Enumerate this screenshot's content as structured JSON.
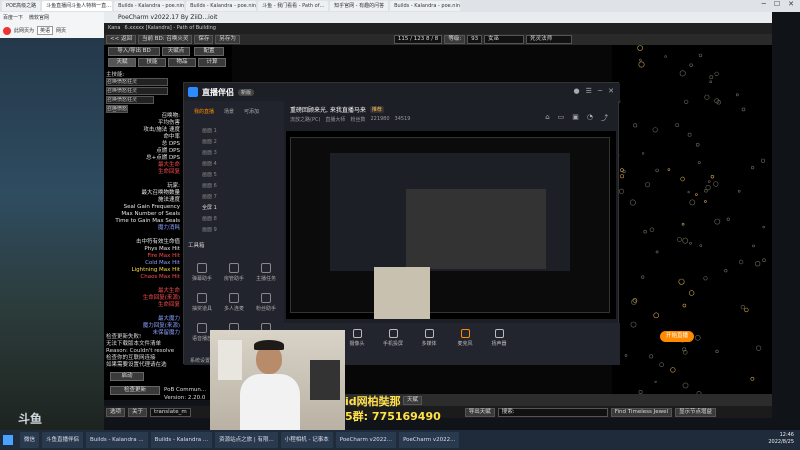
{
  "browser": {
    "tabs": [
      "POE高级之路",
      "斗鱼直播间斗鱼人特档一直…",
      "Builds - Kalandra - poe.ninja",
      "Builds - Kalandra - poe.ninj…",
      "斗鱼 - 我门看看 - Path of…",
      "知乎官网 - 有趣的问答",
      "Builds - Kalandra - poe.ninja"
    ],
    "bookmarks": [
      "百度一下",
      "微软官网"
    ],
    "nav": [
      "此网页为",
      "英语",
      "网页"
    ]
  },
  "poe": {
    "window_title": "PoeCharm v2022.17 By ZiiD...ioit",
    "doc_tabs": [
      "Kana",
      "6.xxxxx [Kalandra] - Path of Building"
    ],
    "toolbar": {
      "back": "<< 返回",
      "build_label": "当前 BD: 召唤火灵",
      "save": "保存",
      "save_as": "另存为",
      "points": "115 / 123   8 / 8",
      "level_label": "等级:",
      "level_value": "93",
      "class_value": "女巫",
      "ascend_value": "死灵法师"
    },
    "left_buttons": {
      "import_export": "导入/导出 BD",
      "notes": "天赋点",
      "config": "配置",
      "tree": "天赋",
      "skills": "技能",
      "items": "物品",
      "calcs": "计算"
    },
    "main_skill_label": "主技能:",
    "main_skill_inputs": [
      "召唤愤怒狂灵",
      "召唤愤怒狂灵",
      "召唤愤怒狂灵",
      "召唤愤怒狂灵"
    ],
    "stats": [
      {
        "t": "召唤物:",
        "c": "w"
      },
      {
        "t": "平均伤害",
        "c": "w"
      },
      {
        "t": "攻击/施法 速度",
        "c": "w"
      },
      {
        "t": "命中率",
        "c": "w"
      },
      {
        "t": "总 DPS",
        "c": "w"
      },
      {
        "t": "点燃 DPS",
        "c": "w"
      },
      {
        "t": "总+点燃 DPS",
        "c": "w"
      },
      {
        "t": "最大生命",
        "c": "r"
      },
      {
        "t": "生命回复",
        "c": "r"
      },
      {
        "t": "",
        "c": "w"
      },
      {
        "t": "玩家:",
        "c": "w"
      },
      {
        "t": "最大召唤物数量",
        "c": "w"
      },
      {
        "t": "施法速度",
        "c": "w"
      },
      {
        "t": "Seal Gain Frequency",
        "c": "w"
      },
      {
        "t": "Max Number of Seals",
        "c": "w"
      },
      {
        "t": "Time to Gain Max Seals",
        "c": "w"
      },
      {
        "t": "魔力消耗",
        "c": "b"
      },
      {
        "t": "",
        "c": "w"
      },
      {
        "t": "击中符有效生命值",
        "c": "w"
      },
      {
        "t": "Phys Max Hit",
        "c": "w"
      },
      {
        "t": "Fire Max Hit",
        "c": "r"
      },
      {
        "t": "Cold Max Hit",
        "c": "b"
      },
      {
        "t": "Lightning Max Hit",
        "c": "y"
      },
      {
        "t": "Chaos Max Hit",
        "c": "r"
      },
      {
        "t": "",
        "c": "w"
      },
      {
        "t": "最大生命",
        "c": "r"
      },
      {
        "t": "生命回复(来源)",
        "c": "r"
      },
      {
        "t": "生命回复",
        "c": "r"
      },
      {
        "t": "",
        "c": "w"
      },
      {
        "t": "最大魔力",
        "c": "b"
      },
      {
        "t": "魔力回复(来源)",
        "c": "b"
      },
      {
        "t": "未保留魔力",
        "c": "b"
      }
    ],
    "update_notice": [
      "检查更新失败!",
      "无法下载版本文件清单",
      "Reason: Couldn't resolve",
      "检查你的互联网连接",
      "如果需要设置代理请在选"
    ],
    "bottom_buttons": {
      "close": "启动",
      "check_update": "检查更新",
      "poe_comm": "PoB Commun...",
      "version": "Version: 2.20.0",
      "options": "选项",
      "about": "关于",
      "translate": "translate_m"
    },
    "bottom_bar": {
      "tree_label": "天赋",
      "export": "导出天赋",
      "search_label": "搜索:",
      "timeless": "Find Timeless Jewel",
      "show_node": "显示节点增益"
    }
  },
  "stream": {
    "app_name": "直播伴侣",
    "badge": "新版",
    "tabs": [
      "我的直播",
      "场景",
      "可添加"
    ],
    "live_title": "重磅回顾来光, 来我直播马来",
    "live_tag": "推荐",
    "meta": [
      "流放之路(PC)",
      "直播大师",
      "粉丝数",
      "221980",
      "34519"
    ],
    "scenes": [
      "画面 1",
      "画面 2",
      "画面 3",
      "画面 4",
      "画面 5",
      "画面 6",
      "画面 7",
      "全屏 1",
      "画面 8",
      "画面 9"
    ],
    "toolbox_label": "工具箱",
    "tools": [
      "弹幕助手",
      "房管助手",
      "主播任务",
      "抽奖道具",
      "多人连麦",
      "粉丝助手",
      "语音播放",
      "虚拟形象",
      "弹幕工具"
    ],
    "settings": "系统设置",
    "bottom_tools": [
      "摄像头",
      "手机投屏",
      "多媒体",
      "麦克风",
      "扬声器"
    ],
    "go_live": "开始直播"
  },
  "overlay": {
    "line1": "id网柏奘那",
    "line2": "5群: 775169490"
  },
  "taskbar": {
    "items": [
      "微信",
      "斗鱼直播伴侣",
      "Builds - Kalandra ...",
      "Builds - Kalandra ...",
      "资源站点之旅 | 有限...",
      "小程相机 - 记事本",
      "PoeCharm v2022...",
      "PoeCharm v2022..."
    ],
    "time": "12:46",
    "date": "2022/8/25"
  },
  "watermark": "斗鱼"
}
